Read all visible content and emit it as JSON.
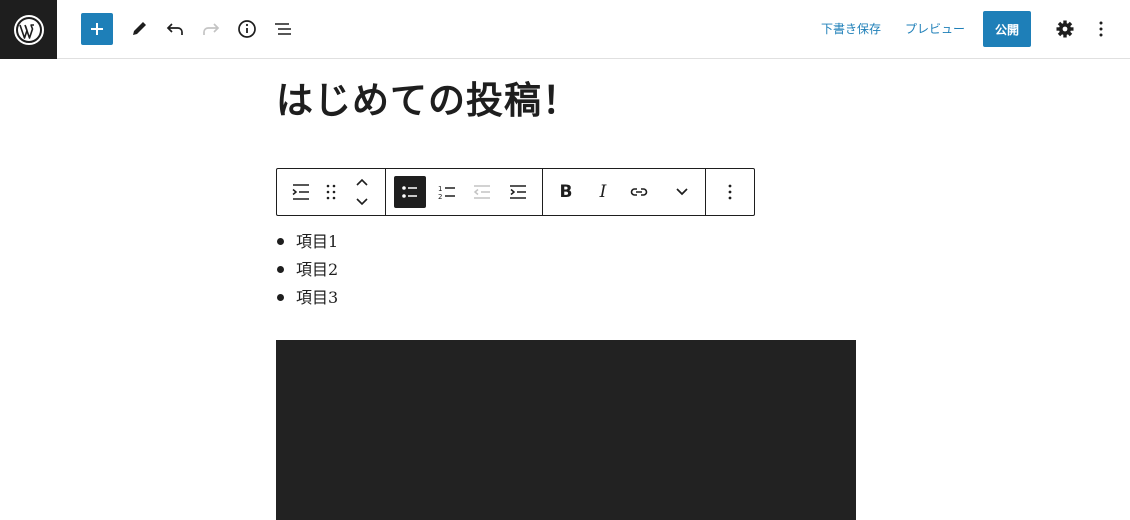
{
  "header": {
    "save_draft_label": "下書き保存",
    "preview_label": "プレビュー",
    "publish_label": "公開",
    "icons": [
      "wordpress-logo-icon",
      "plus-icon",
      "pencil-icon",
      "undo-icon",
      "redo-icon",
      "info-icon",
      "list-view-icon",
      "gear-icon",
      "more-vertical-icon"
    ]
  },
  "post": {
    "title": "はじめての投稿！",
    "list_items": [
      "項目1",
      "項目2",
      "項目3"
    ]
  },
  "block_toolbar": {
    "icons": [
      "list-block-icon",
      "drag-handle-icon",
      "move-up-icon",
      "move-down-icon",
      "unordered-list-icon",
      "ordered-list-icon",
      "outdent-icon",
      "indent-icon",
      "bold-icon",
      "italic-icon",
      "link-icon",
      "chevron-down-icon",
      "more-vertical-icon"
    ],
    "bold_glyph": "B",
    "italic_glyph": "I"
  },
  "colors": {
    "accent": "#1e7fb8",
    "dark": "#1e1e1e",
    "video_bg": "#222222"
  }
}
